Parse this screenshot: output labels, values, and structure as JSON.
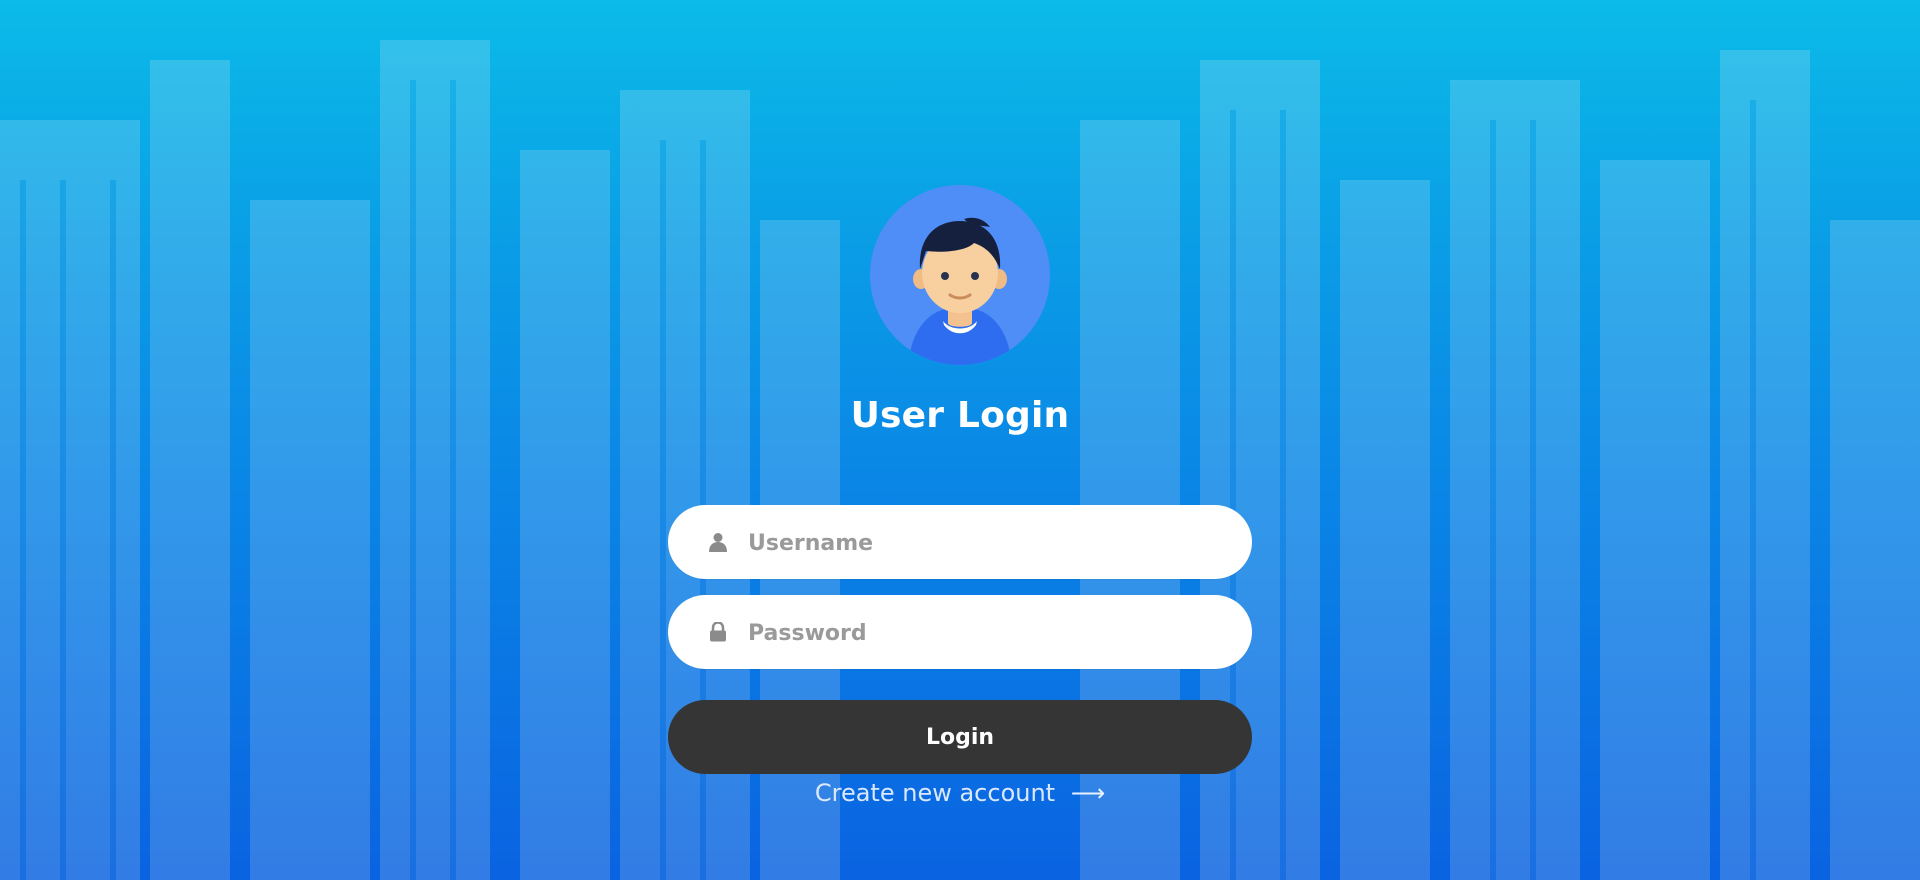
{
  "login": {
    "title": "User Login",
    "username_placeholder": "Username",
    "password_placeholder": "Password",
    "login_label": "Login",
    "create_account_label": "Create new account",
    "create_account_arrow": "⟶"
  },
  "icons": {
    "avatar": "avatar-icon",
    "username": "user-icon",
    "password": "lock-icon",
    "create_account": "arrow-right-icon"
  },
  "colors": {
    "background_top": "#0bbbe8",
    "background_bottom": "#0a63e1",
    "avatar_circle": "#4f8ef7",
    "field_background": "#ffffff",
    "button_background": "#353535",
    "title_text": "#ffffff",
    "link_text": "#d9e8ff"
  }
}
